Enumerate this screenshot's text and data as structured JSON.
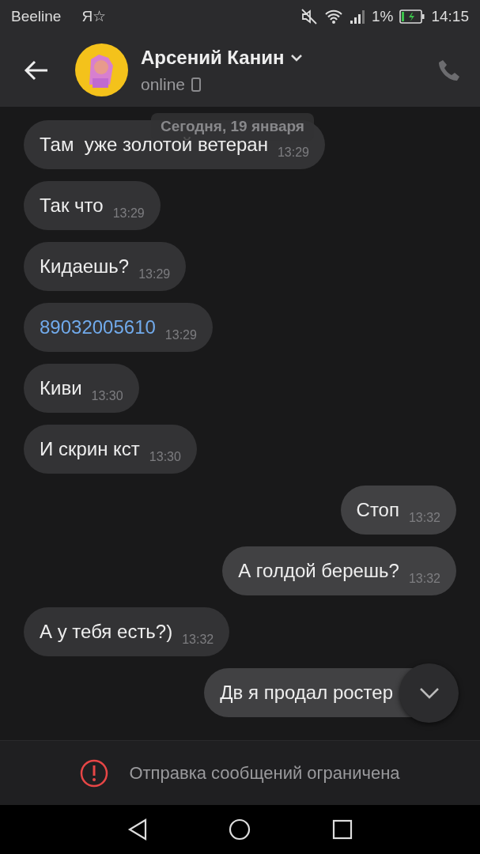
{
  "status_bar": {
    "carrier": "Beeline",
    "app_glyph": "Я☆",
    "battery_percent": "1%",
    "time": "14:15"
  },
  "header": {
    "name": "Арсений Канин",
    "status": "online"
  },
  "date_chip": "Сегодня, 19 января",
  "messages": [
    {
      "outgoing": false,
      "kind": "text",
      "text": "Там  уже золотой ветеран",
      "time": "13:29"
    },
    {
      "outgoing": false,
      "kind": "text",
      "text": "Так что",
      "time": "13:29"
    },
    {
      "outgoing": false,
      "kind": "text",
      "text": "Кидаешь?",
      "time": "13:29"
    },
    {
      "outgoing": false,
      "kind": "link",
      "text": "89032005610",
      "time": "13:29"
    },
    {
      "outgoing": false,
      "kind": "text",
      "text": "Киви",
      "time": "13:30"
    },
    {
      "outgoing": false,
      "kind": "text",
      "text": "И скрин кст",
      "time": "13:30"
    },
    {
      "outgoing": true,
      "kind": "text",
      "text": "Стоп",
      "time": "13:32"
    },
    {
      "outgoing": true,
      "kind": "text",
      "text": "А голдой берешь?",
      "time": "13:32"
    },
    {
      "outgoing": false,
      "kind": "text",
      "text": "А у тебя есть?)",
      "time": "13:32"
    },
    {
      "outgoing": true,
      "kind": "text",
      "text": "Дв я продал ростер"
    }
  ],
  "restriction": "Отправка сообщений ограничена"
}
